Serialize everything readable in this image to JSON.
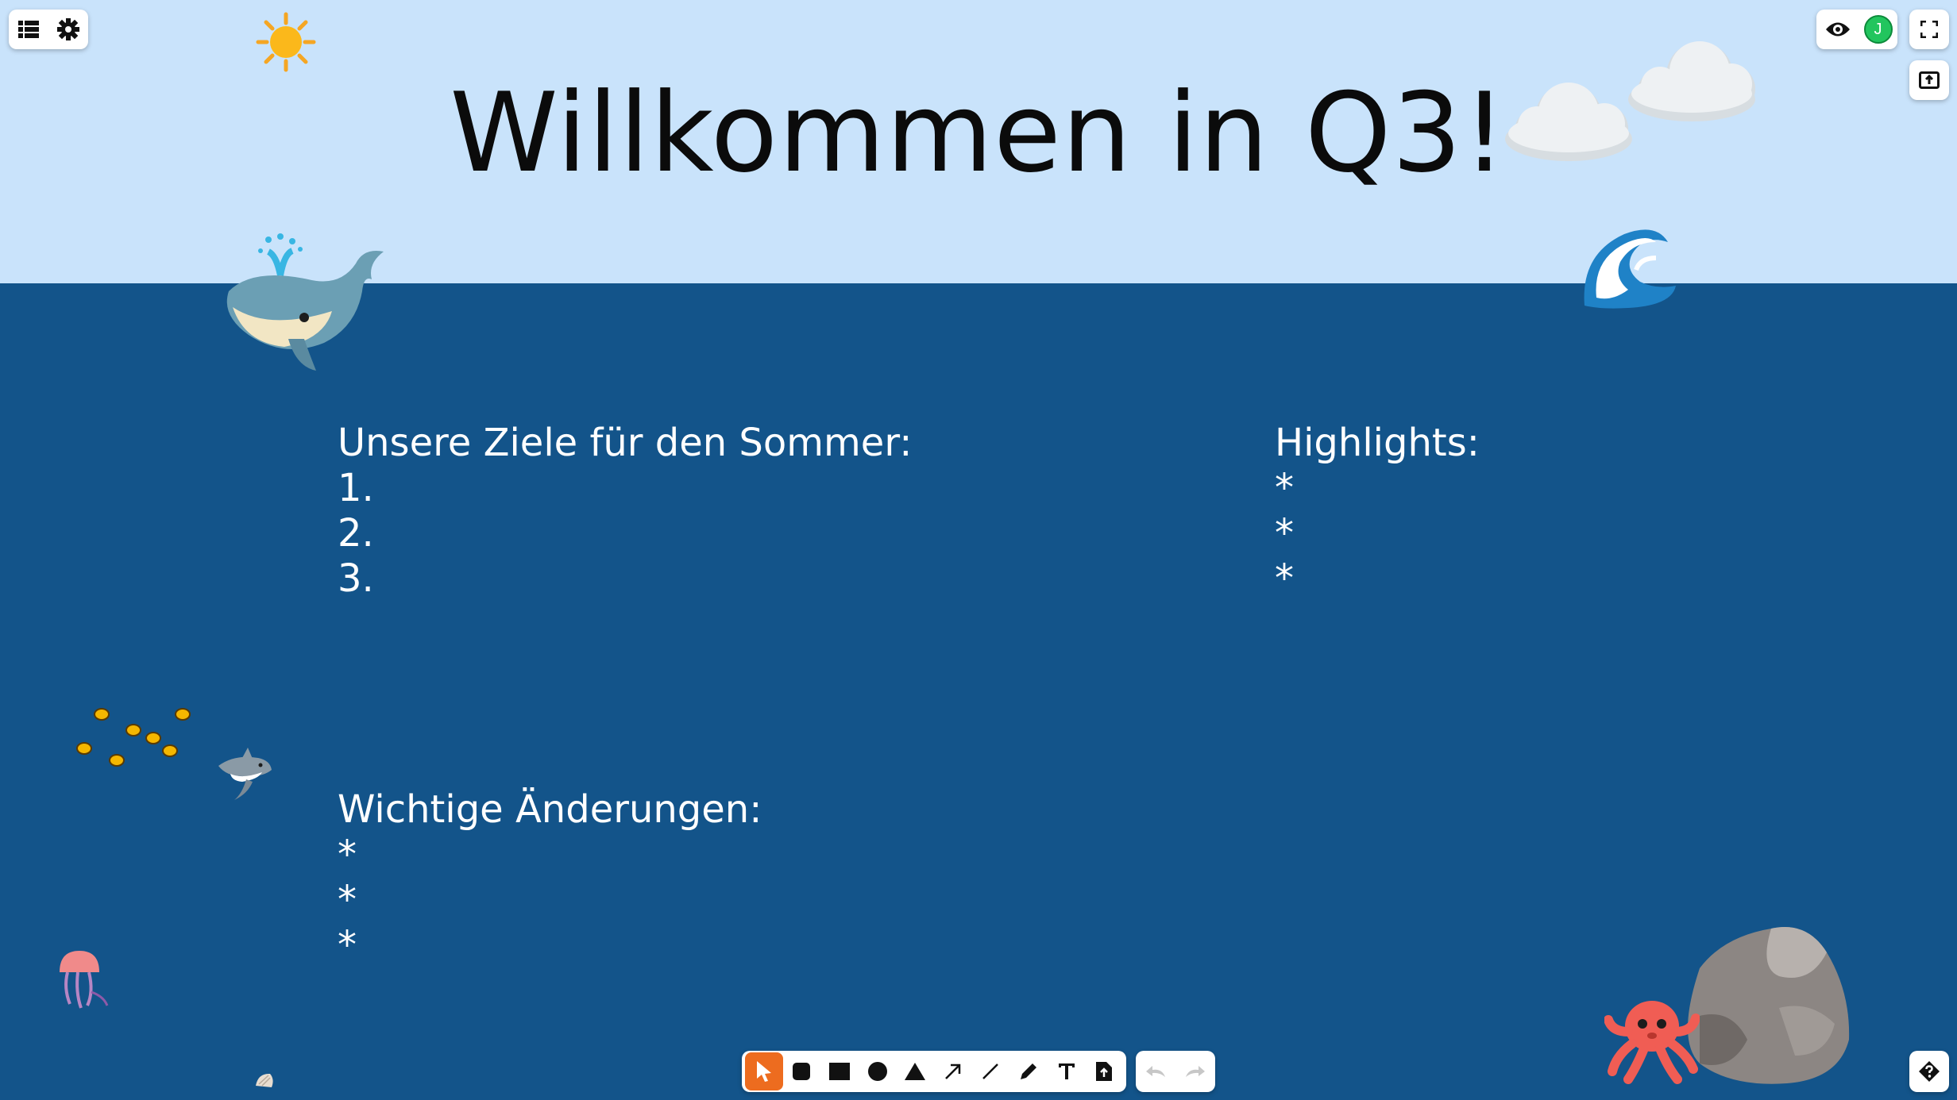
{
  "board": {
    "title": "Willkommen in Q3!",
    "goals": {
      "heading": "Unsere Ziele für den Sommer:",
      "items": [
        "1.",
        "2.",
        "3."
      ]
    },
    "highlights": {
      "heading": "Highlights:",
      "items": [
        "*",
        "*",
        "*"
      ]
    },
    "changes": {
      "heading": "Wichtige Änderungen:",
      "items": [
        "*",
        "*",
        "*"
      ]
    }
  },
  "user": {
    "initial": "J"
  },
  "colors": {
    "sky": "#c9e3fb",
    "sea": "#13548a",
    "accent": "#ed6c1f",
    "avatar": "#22c55e"
  },
  "toolbar": {
    "tools": [
      "select-icon",
      "rounded-rectangle-icon",
      "rectangle-icon",
      "ellipse-icon",
      "triangle-icon",
      "arrow-icon",
      "line-icon",
      "pen-icon",
      "text-icon",
      "file-upload-icon"
    ],
    "active": "select-icon"
  },
  "decorations": [
    "sun",
    "cloud",
    "cloud",
    "whale",
    "wave",
    "tropical-fish",
    "shark",
    "jellyfish",
    "shell",
    "octopus",
    "rock"
  ]
}
